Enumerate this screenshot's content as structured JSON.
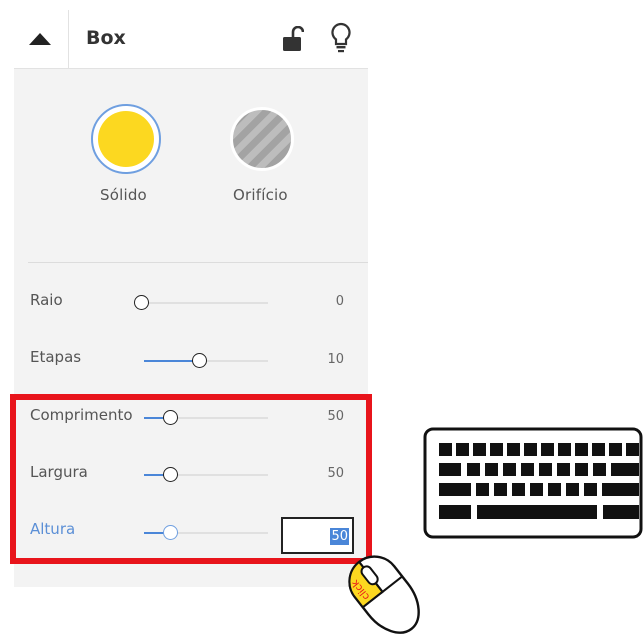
{
  "header": {
    "title": "Box"
  },
  "shape_types": [
    {
      "label": "Sólido",
      "color": "#fcd820",
      "selected": true
    },
    {
      "label": "Orifício",
      "selected": false
    }
  ],
  "sliders": [
    {
      "label": "Raio",
      "value": "0",
      "fraction": 0.0
    },
    {
      "label": "Etapas",
      "value": "10",
      "fraction": 0.45
    },
    {
      "label": "Comprimento",
      "value": "50",
      "fraction": 0.22
    },
    {
      "label": "Largura",
      "value": "50",
      "fraction": 0.22
    },
    {
      "label": "Altura",
      "value": "50",
      "fraction": 0.22
    }
  ],
  "active_input": {
    "value": "50"
  },
  "mouse": {
    "label": "click"
  },
  "colors": {
    "accent": "#4a86d8",
    "highlight": "#e8141b",
    "solid_fill": "#fcd820"
  }
}
